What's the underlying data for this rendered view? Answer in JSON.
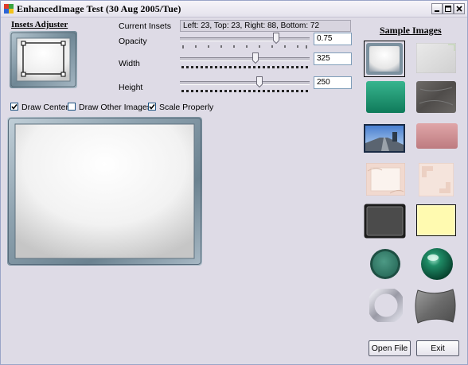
{
  "window": {
    "title": "EnhancedImage Test (30 Aug 2005/Tue)",
    "controls": {
      "minimize_icon": "minimize-icon",
      "maximize_icon": "maximize-icon",
      "close_icon": "close-icon"
    }
  },
  "insets_adjuster": {
    "title": "Insets Adjuster"
  },
  "current_insets": {
    "label": "Current Insets",
    "value": "Left: 23, Top: 23, Right: 88, Bottom: 72"
  },
  "opacity": {
    "label": "Opacity",
    "value": "0.75"
  },
  "width": {
    "label": "Width",
    "value": "325"
  },
  "height": {
    "label": "Height",
    "value": "250"
  },
  "checkboxes": {
    "draw_center": {
      "label": "Draw Center",
      "checked": true
    },
    "draw_other_images": {
      "label": "Draw Other Images",
      "checked": false
    },
    "scale_properly": {
      "label": "Scale Properly",
      "checked": true
    }
  },
  "sample_images": {
    "title": "Sample Images",
    "items": [
      "silver-frame",
      "light-gray-panel",
      "teal-green-panel",
      "dark-granite-panel",
      "road-photo",
      "pink-panel",
      "marble-frame",
      "marble-corner-frame",
      "dark-square-button",
      "pale-yellow-panel",
      "teal-round-button",
      "teal-glossy-sphere",
      "silver-ring",
      "gray-wavy-tile"
    ],
    "selected_index": 0
  },
  "buttons": {
    "open_file": "Open File",
    "exit": "Exit"
  },
  "colors": {
    "window_bg": "#dedbe6",
    "frame_steel": "#7e93a3",
    "selection": "#000000"
  }
}
